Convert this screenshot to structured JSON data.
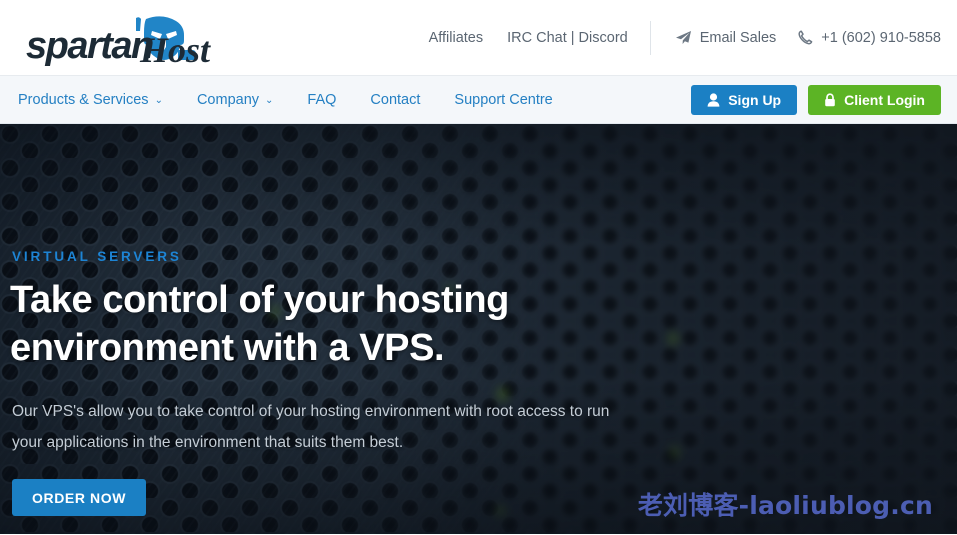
{
  "brand": {
    "name": "spartanHost",
    "word_one": "spartan",
    "word_two": "Host",
    "helmet_color": "#2185c7",
    "wordmark_color": "#1d2b36"
  },
  "topbar": {
    "links": [
      {
        "label": "Affiliates",
        "name": "affiliates"
      },
      {
        "label": "IRC Chat | Discord",
        "name": "irc-chat-discord"
      }
    ],
    "contacts": [
      {
        "label": "Email Sales",
        "icon": "paper-plane-icon",
        "name": "email-sales"
      },
      {
        "label": "+1 (602) 910-5858",
        "icon": "phone-icon",
        "name": "phone-number"
      }
    ]
  },
  "mainnav": {
    "items": [
      {
        "label": "Products & Services",
        "caret": "⌄",
        "has_dropdown": true
      },
      {
        "label": "Company",
        "caret": "⌄",
        "has_dropdown": true
      },
      {
        "label": "FAQ",
        "caret": "",
        "has_dropdown": false
      },
      {
        "label": "Contact",
        "caret": "",
        "has_dropdown": false
      },
      {
        "label": "Support Centre",
        "caret": "",
        "has_dropdown": false
      }
    ],
    "signup_label": "Sign Up",
    "login_label": "Client Login",
    "signup_color": "#1b80c4",
    "login_color": "#5cb425"
  },
  "hero": {
    "eyebrow": "VIRTUAL SERVERS",
    "title": "Take control of your hosting environment with a VPS.",
    "subtitle": "Our VPS's allow you to take control of your hosting environment with root access to run your applications in the environment that suits them best.",
    "cta_label": "ORDER NOW",
    "cta_color": "#1b80c4",
    "eyebrow_color": "#1d84d4"
  },
  "watermark": {
    "text": "老刘博客-laoliublog.cn",
    "color": "#5a6ed4"
  }
}
